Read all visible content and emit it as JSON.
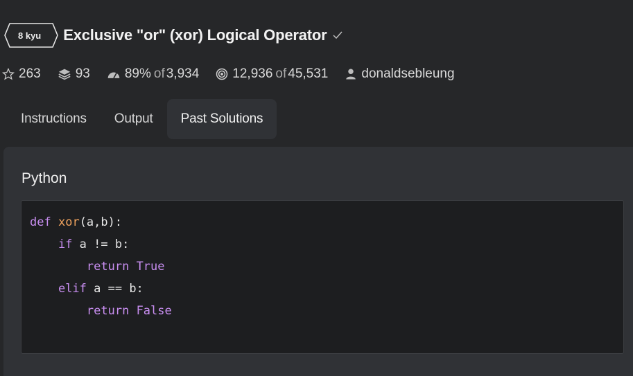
{
  "kata": {
    "rank": "8 kyu",
    "title": "Exclusive \"or\" (xor) Logical Operator"
  },
  "stats": {
    "stars": "263",
    "collections": "93",
    "satisfaction": "89%",
    "votes_of": "of",
    "votes": "3,934",
    "completed": "12,936",
    "attempts_of": "of",
    "attempts": "45,531",
    "author": "donaldsebleung"
  },
  "tabs": [
    {
      "label": "Instructions"
    },
    {
      "label": "Output"
    },
    {
      "label": "Past Solutions"
    }
  ],
  "solution": {
    "language": "Python",
    "code": [
      {
        "indent": "",
        "tokens": [
          {
            "t": "def",
            "c": "kw"
          },
          {
            "t": " ",
            "c": ""
          },
          {
            "t": "xor",
            "c": "fn"
          },
          {
            "t": "(a,b):",
            "c": ""
          }
        ]
      },
      {
        "indent": "    ",
        "tokens": [
          {
            "t": "if",
            "c": "kw"
          },
          {
            "t": " a != b:",
            "c": ""
          }
        ]
      },
      {
        "indent": "        ",
        "tokens": [
          {
            "t": "return",
            "c": "kw"
          },
          {
            "t": " ",
            "c": ""
          },
          {
            "t": "True",
            "c": "bi"
          }
        ]
      },
      {
        "indent": "    ",
        "tokens": [
          {
            "t": "elif",
            "c": "kw"
          },
          {
            "t": " a == b:",
            "c": ""
          }
        ]
      },
      {
        "indent": "        ",
        "tokens": [
          {
            "t": "return",
            "c": "kw"
          },
          {
            "t": " ",
            "c": ""
          },
          {
            "t": "False",
            "c": "bi"
          }
        ]
      }
    ]
  },
  "icons": {
    "star": "star-icon",
    "collections": "stack-icon",
    "satisfaction": "gauge-icon",
    "completed": "target-icon",
    "author": "user-icon",
    "approved": "check-icon"
  },
  "colors": {
    "keyword": "#c88ef0",
    "function": "#f0a35e",
    "background": "#262729",
    "panel": "#303236",
    "code_bg": "#1d1e20"
  }
}
